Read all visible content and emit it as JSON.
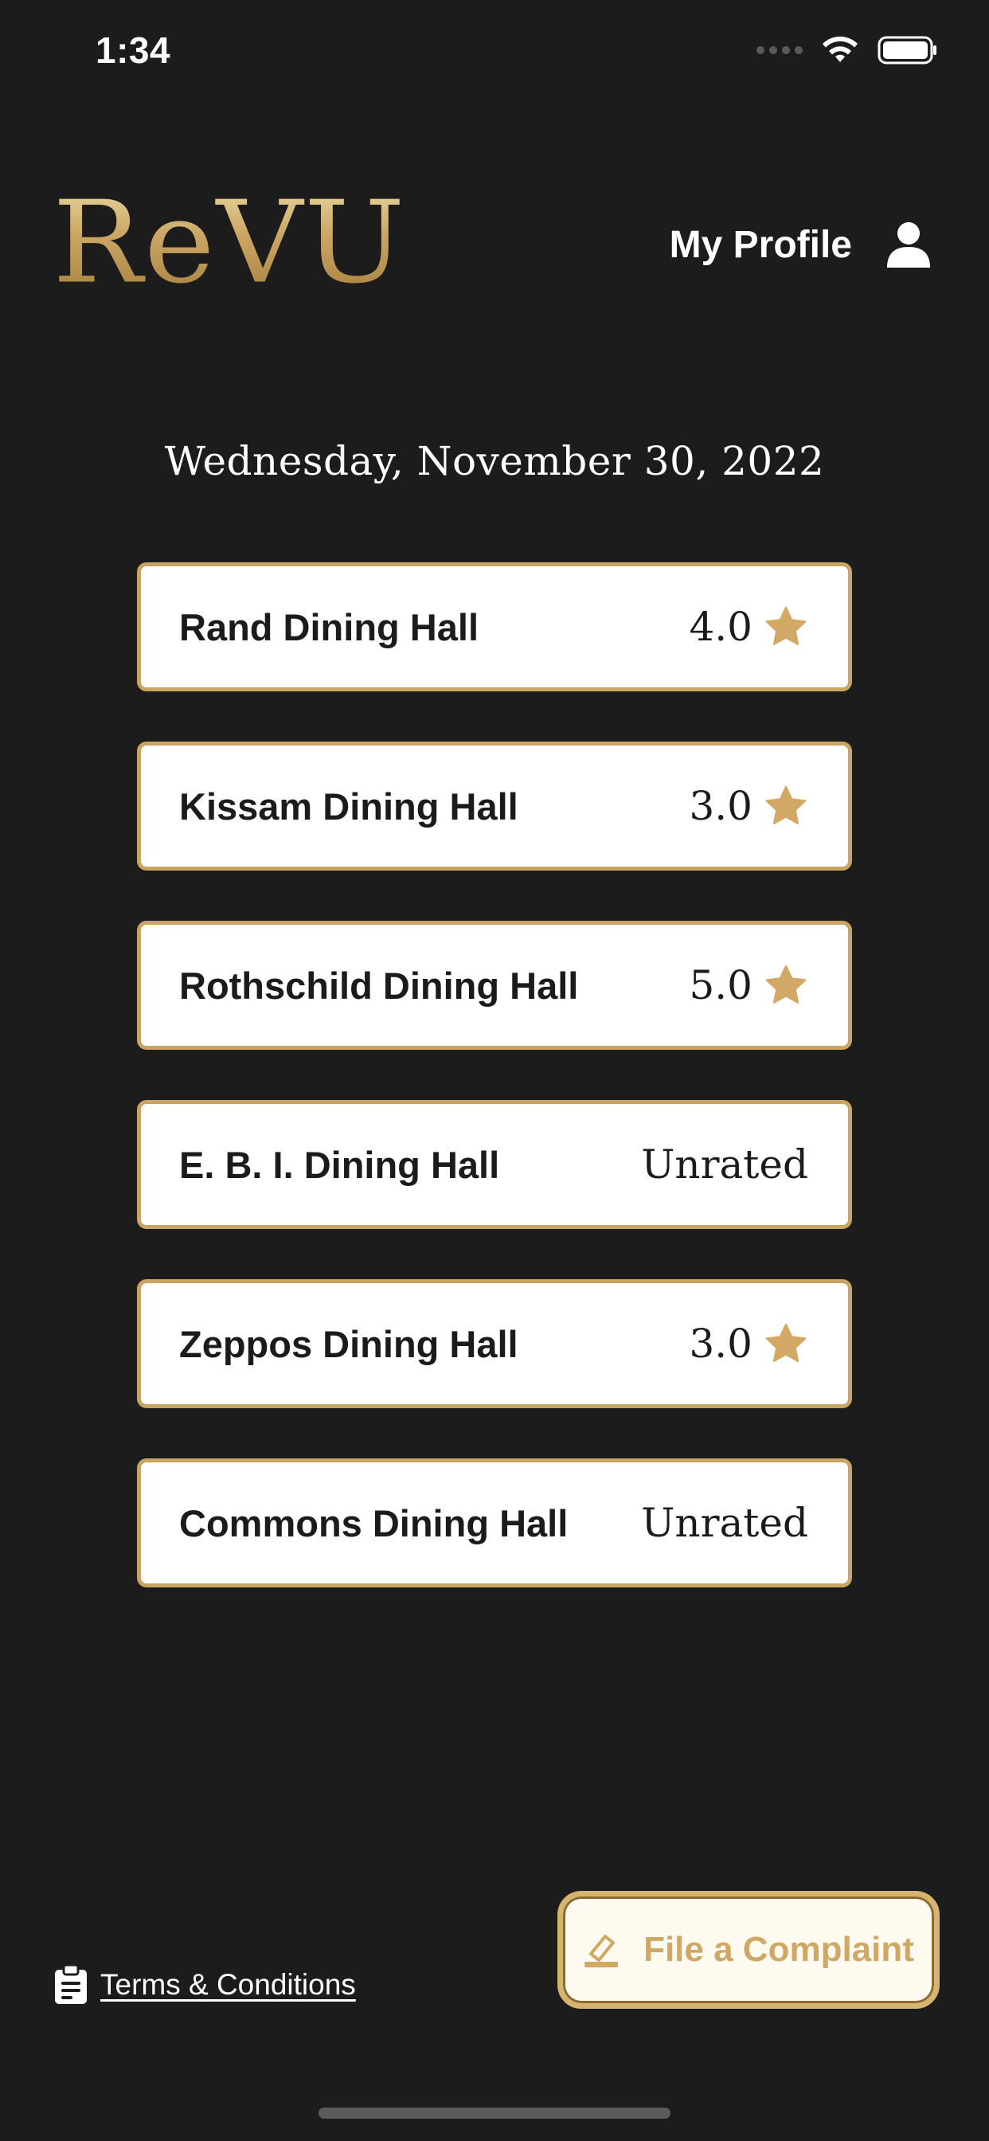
{
  "status_bar": {
    "time": "1:34"
  },
  "header": {
    "logo": "ReVU",
    "profile_label": "My Profile"
  },
  "date": "Wednesday, November 30, 2022",
  "halls": [
    {
      "name": "Rand Dining Hall",
      "rating": "4.0",
      "rated": true
    },
    {
      "name": "Kissam Dining Hall",
      "rating": "3.0",
      "rated": true
    },
    {
      "name": "Rothschild Dining Hall",
      "rating": "5.0",
      "rated": true
    },
    {
      "name": "E. B. I. Dining Hall",
      "rating": "Unrated",
      "rated": false
    },
    {
      "name": "Zeppos Dining Hall",
      "rating": "3.0",
      "rated": true
    },
    {
      "name": "Commons Dining Hall",
      "rating": "Unrated",
      "rated": false
    }
  ],
  "footer": {
    "complaint_label": "File a Complaint",
    "terms_label": "Terms & Conditions"
  },
  "colors": {
    "background": "#1c1c1c",
    "accent_gold": "#c9a463",
    "card": "#ffffff"
  },
  "icons": {
    "profile": "person-icon",
    "rating": "star-icon",
    "complaint": "pencil-eraser-icon",
    "terms": "clipboard-icon"
  }
}
